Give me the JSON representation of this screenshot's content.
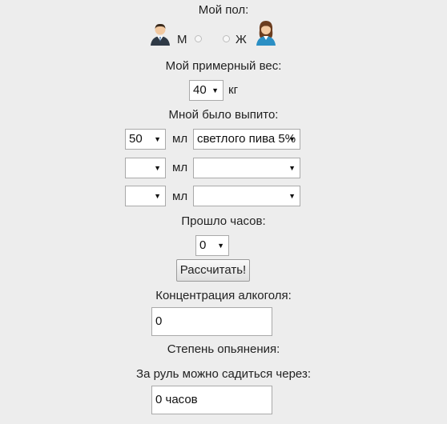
{
  "gender": {
    "title": "Мой пол:",
    "male_label": "М",
    "female_label": "Ж",
    "male_icon": "male-user-icon",
    "female_icon": "female-user-icon"
  },
  "weight": {
    "title": "Мой примерный вес:",
    "value": "40",
    "unit": "кг"
  },
  "drinks": {
    "title": "Мной было выпито:",
    "unit": "мл",
    "rows": [
      {
        "amount": "50",
        "type": "светлого пива 5%"
      },
      {
        "amount": "",
        "type": ""
      },
      {
        "amount": "",
        "type": ""
      }
    ]
  },
  "hours": {
    "title": "Прошло часов:",
    "value": "0"
  },
  "calculate_button": "Рассчитать!",
  "concentration": {
    "title": "Концентрация алкоголя:",
    "value": "0"
  },
  "intoxication": {
    "title": "Степень опьянения:"
  },
  "drive": {
    "title": "За руль можно садиться через:",
    "value": "0 часов"
  }
}
